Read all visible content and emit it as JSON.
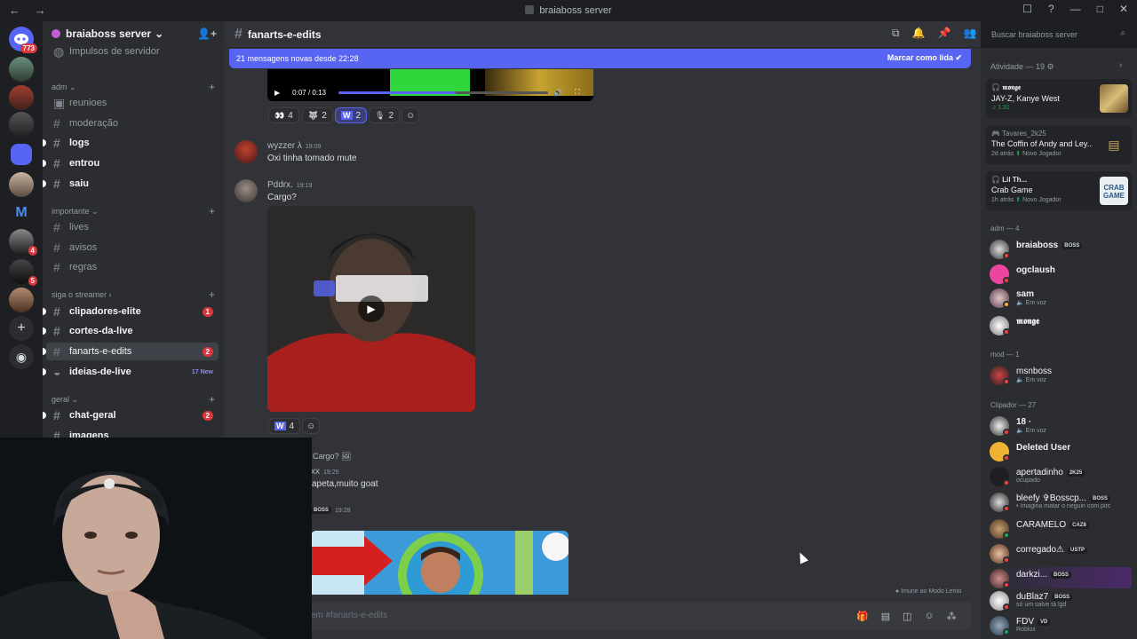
{
  "titlebar": {
    "title": "braiaboss server",
    "nav": "← →",
    "controls": [
      "☐",
      "?",
      "—",
      "□",
      "✕"
    ]
  },
  "rail": {
    "home_badge": "773",
    "badges": {
      "b1": "4",
      "b2": "5"
    }
  },
  "sidebar": {
    "server_name": "braiaboss server",
    "boosts": "Impulsos de servidor",
    "categories": {
      "adm": "adm",
      "importante": "importante",
      "siga": "siga o streamer",
      "geral": "geral"
    },
    "channels": {
      "reunioes": "reunioes",
      "moderacao": "moderação",
      "logs": "logs",
      "entrou": "entrou",
      "saiu": "saiu",
      "lives": "lives",
      "avisos": "avisos",
      "regras": "regras",
      "clipadores": "clipadores-elite",
      "clipadores_badge": "1",
      "cortes": "cortes-da-live",
      "fanarts": "fanarts-e-edits",
      "fanarts_badge": "2",
      "ideias": "ideias-de-live",
      "ideias_new": "17 New",
      "chatgeral": "chat-geral",
      "chatgeral_badge": "2",
      "imagens": "imagens"
    }
  },
  "header": {
    "channel": "fanarts-e-edits",
    "search_placeholder": "Buscar braiaboss server"
  },
  "banner": {
    "text": "21 mensagens novas desde 22:28",
    "action": "Marcar como lida"
  },
  "video": {
    "time": "0:07 / 0:13",
    "progress": 0.56
  },
  "reactions1": [
    {
      "emoji": "👀",
      "count": "4"
    },
    {
      "emoji": "🐺",
      "count": "2"
    },
    {
      "emoji": "W",
      "count": "2"
    },
    {
      "emoji": "🎙",
      "count": "2"
    }
  ],
  "messages": {
    "m1_user": "wyzzer λ",
    "m1_time": "19:09",
    "m1_text": "Oxi tinha tomado mute",
    "m2_user": "Pddrx.",
    "m2_time": "19:19",
    "m2_text": "Cargo?",
    "m2_react_count": "4",
    "m3_reply": "Cargo?",
    "m3_user": "xx",
    "m3_time": "19:25",
    "m3_text": "apeta,muito goat",
    "m4_tag": "BOSS",
    "m4_time": "19:28"
  },
  "slowmode": "Imune ao Modo Lento",
  "composer": {
    "placeholder": "em #fanarts-e-edits"
  },
  "activity": {
    "title": "Atividade — 19",
    "cards": [
      {
        "user": "𝖒𝖔𝖓𝖌𝖊",
        "title": "JAY-Z, Kanye West",
        "meta": "1:31",
        "extra": ""
      },
      {
        "user": "Tavares_2k25",
        "title": "The Coffin of Andy and Ley...",
        "meta": "2d atrás",
        "extra": "Novo Jogador"
      },
      {
        "user": "Lil Th...",
        "title": "Crab Game",
        "meta": "1h atrás",
        "extra": "Novo Jogador"
      }
    ]
  },
  "member_groups": {
    "adm": "adm — 4",
    "mod": "mod — 1",
    "clip": "Clipador — 27"
  },
  "members": [
    {
      "name": "braiaboss",
      "tag": "BOSS",
      "sub": ""
    },
    {
      "name": "ogclaush",
      "tag": "",
      "sub": ""
    },
    {
      "name": "sam",
      "tag": "",
      "sub": "Em voz"
    },
    {
      "name": "𝖒𝖔𝖓𝖌𝖊",
      "tag": "",
      "sub": ""
    },
    {
      "name": "msnboss",
      "tag": "",
      "sub": "Em voz"
    },
    {
      "name": "18 ·",
      "tag": "",
      "sub": "Em voz"
    },
    {
      "name": "Deleted User",
      "tag": "",
      "sub": ""
    },
    {
      "name": "apertadinho",
      "tag": "2K25",
      "sub": "ocupado"
    },
    {
      "name": "bleefy ✞Bosscp...",
      "tag": "BOSS",
      "sub": "• Imagina matar o neguin com pirc"
    },
    {
      "name": "CARAMELO",
      "tag": "CAZ8",
      "sub": ""
    },
    {
      "name": "corregado⚠",
      "tag": "USTP",
      "sub": ""
    },
    {
      "name": "darkzi...",
      "tag": "BOSS",
      "sub": ""
    },
    {
      "name": "duBlaz7",
      "tag": "BOSS",
      "sub": "só um salve tá lgd"
    },
    {
      "name": "FDV",
      "tag": "VD",
      "sub": "Roblox"
    }
  ]
}
